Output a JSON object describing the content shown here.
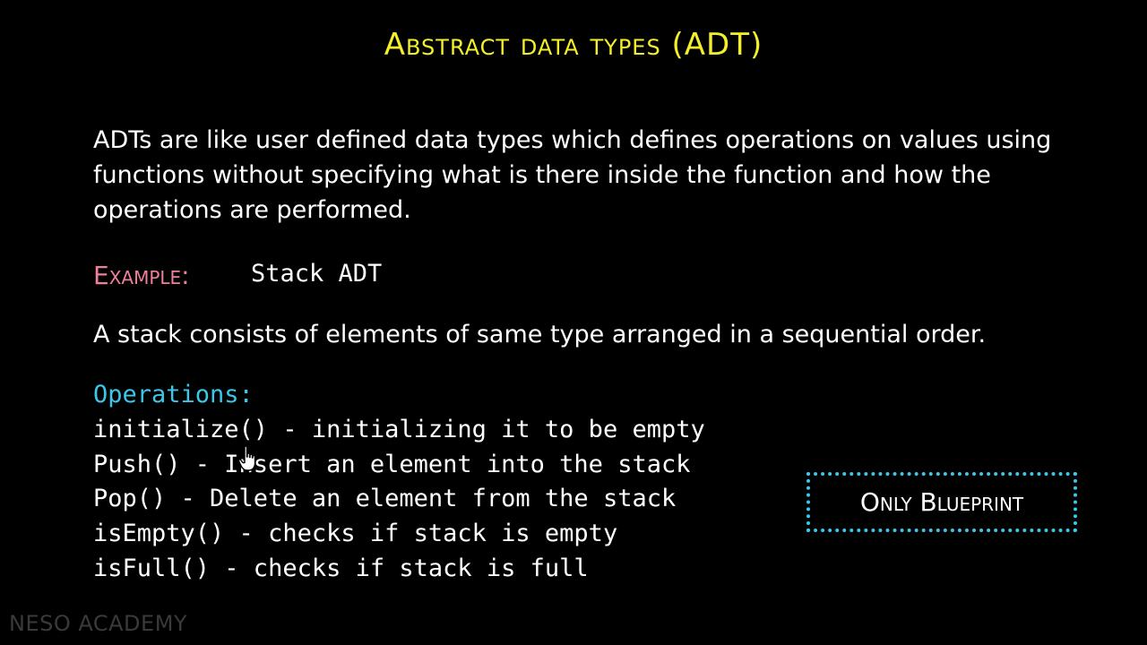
{
  "slide": {
    "title": "Abstract data types (ADT)",
    "definition": "ADTs are like user defined data types which defines operations on values using functions without specifying what is there inside the function and how the operations are performed.",
    "example_label": "Example:",
    "example_value": "Stack ADT",
    "stack_description": "A stack consists of elements of same type arranged in a sequential order.",
    "operations_heading": "Operations:",
    "operations": [
      "initialize() - initializing it to be empty",
      "Push() - Insert an element into the stack",
      "Pop() - Delete an element from the stack",
      "isEmpty() - checks if stack is empty",
      "isFull() - checks if stack is full"
    ],
    "callout": "Only Blueprint",
    "watermark": "NESO ACADEMY"
  },
  "colors": {
    "background": "#000000",
    "title": "#f4ef2a",
    "example_label": "#f07f9a",
    "operations_heading": "#3cc7e8",
    "callout_border": "#3cc7e8",
    "watermark": "#3a3a3a"
  },
  "icons": {
    "cursor": "hand-pointer-icon"
  }
}
